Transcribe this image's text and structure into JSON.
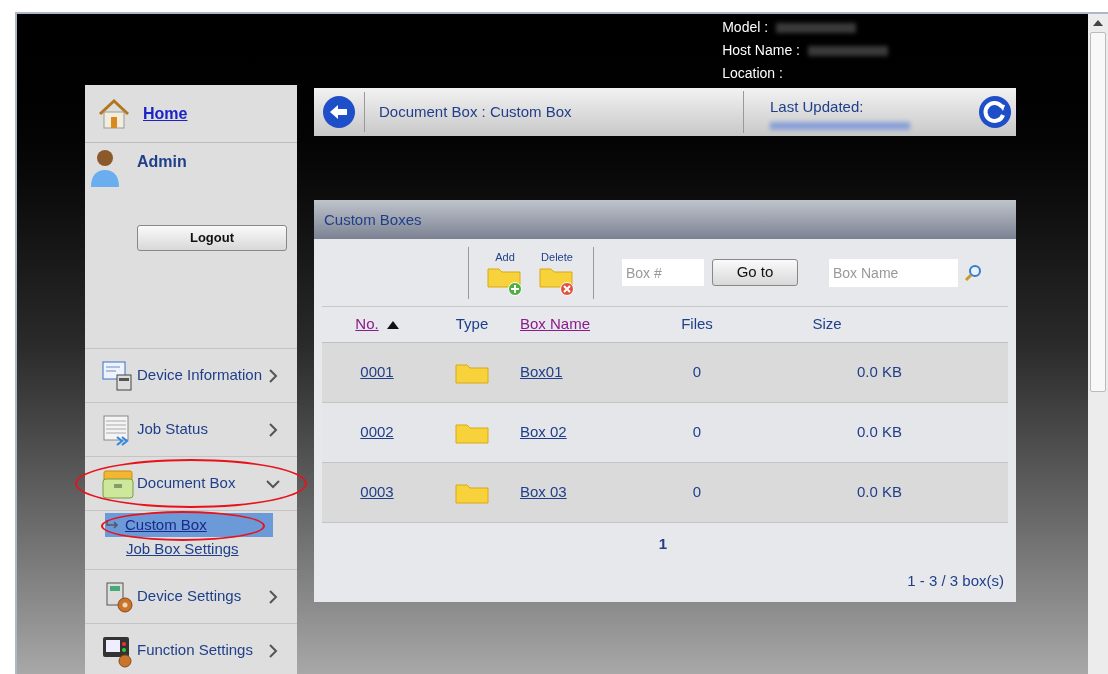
{
  "header": {
    "info": [
      {
        "label": "Model :",
        "redacted": true
      },
      {
        "label": "Host Name :",
        "redacted": true
      },
      {
        "label": "Location :",
        "redacted": false
      }
    ]
  },
  "sidebar": {
    "home": "Home",
    "user": "Admin",
    "logout": "Logout",
    "items": [
      {
        "label": "Device Information",
        "kind": "info",
        "expanded": false,
        "highlighted": false
      },
      {
        "label": "Job Status",
        "kind": "jobs",
        "expanded": false,
        "highlighted": false
      },
      {
        "label": "Document Box",
        "kind": "docbox",
        "expanded": true,
        "highlighted": true,
        "children": [
          {
            "label": "Custom Box",
            "selected": true,
            "highlighted": true
          },
          {
            "label": "Job Box Settings",
            "selected": false,
            "highlighted": false
          }
        ]
      },
      {
        "label": "Device Settings",
        "kind": "devset",
        "expanded": false,
        "highlighted": false
      },
      {
        "label": "Function Settings",
        "kind": "funcset",
        "expanded": false,
        "highlighted": false
      }
    ]
  },
  "breadcrumb": {
    "path": "Document Box : Custom Box",
    "last_updated_label": "Last Updated:"
  },
  "panel": {
    "title": "Custom Boxes",
    "add": "Add",
    "delete": "Delete",
    "box_number_placeholder": "Box #",
    "goto": "Go to",
    "box_name_placeholder": "Box Name",
    "columns": [
      {
        "label": "No.",
        "link": true,
        "sorted": true
      },
      {
        "label": "Type",
        "link": false,
        "sorted": false
      },
      {
        "label": "Box Name",
        "link": true,
        "sorted": false
      },
      {
        "label": "Files",
        "link": false,
        "sorted": false
      },
      {
        "label": "Size",
        "link": false,
        "sorted": false
      }
    ],
    "rows": [
      {
        "no": "0001",
        "name": "Box01",
        "files": "0",
        "size": "0.0 KB"
      },
      {
        "no": "0002",
        "name": "Box 02",
        "files": "0",
        "size": "0.0 KB"
      },
      {
        "no": "0003",
        "name": "Box 03",
        "files": "0",
        "size": "0.0 KB"
      }
    ],
    "page": "1",
    "count": "1 - 3 / 3 box(s)"
  }
}
